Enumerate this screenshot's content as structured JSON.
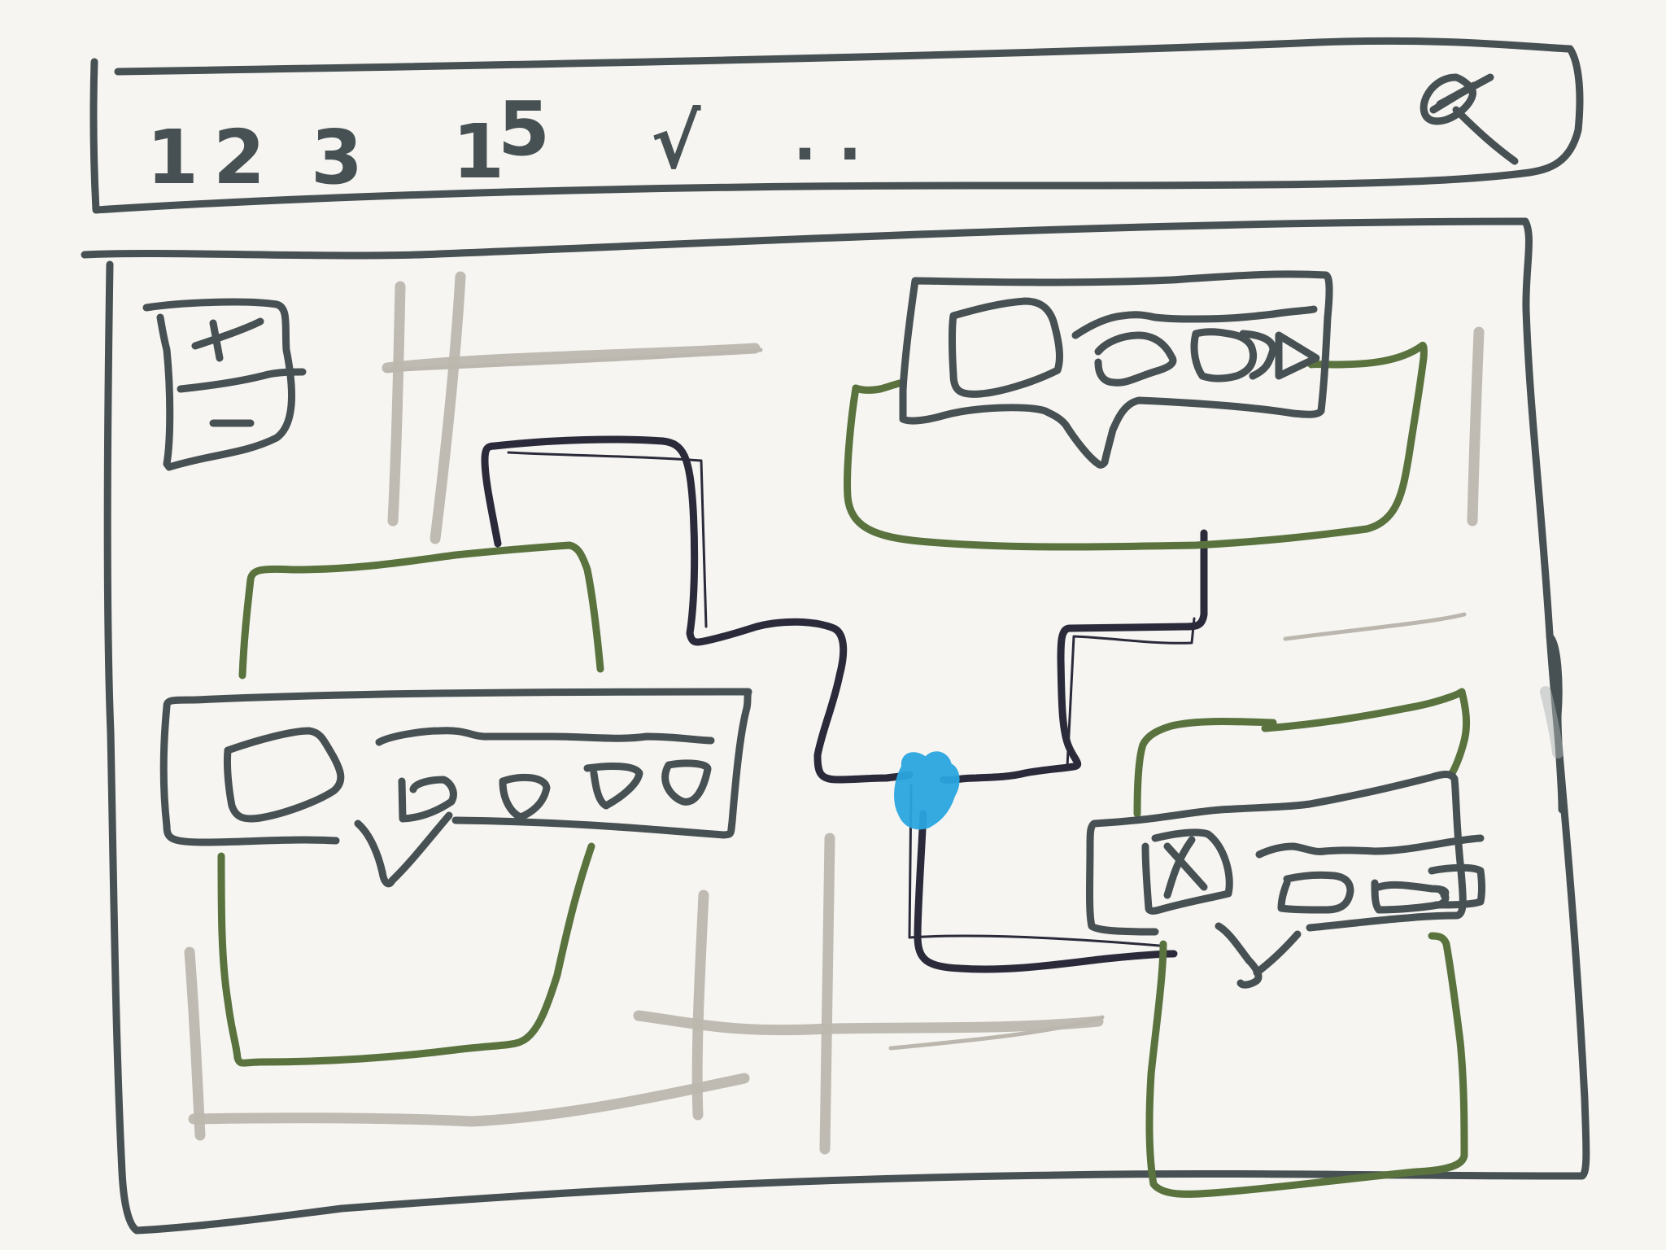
{
  "toolbar": {
    "breadcrumb": [
      "1",
      "2",
      "3",
      "1",
      "5",
      "√"
    ],
    "ellipsis": ". ."
  },
  "colors": {
    "ink": "#475052",
    "wire": "#2b2a3b",
    "group": "#5a733e",
    "grid": "#bcb7ae",
    "selected": "#2aa6e0",
    "paper": "#f6f5f2"
  },
  "icons": [
    "search-icon",
    "zoom-plus-icon",
    "zoom-minus-icon",
    "play-icon",
    "close-icon",
    "chat-bubble-icon"
  ]
}
